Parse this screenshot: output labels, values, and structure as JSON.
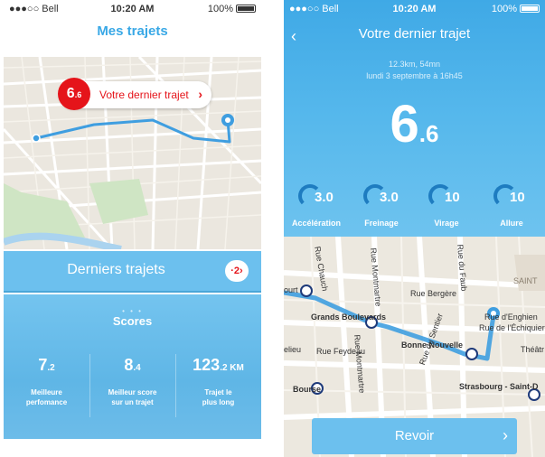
{
  "left": {
    "status": {
      "carrier": "●●●○○ Bell",
      "time": "10:20 AM",
      "battery": "100%"
    },
    "title": "Mes trajets",
    "last_trip": {
      "score_main": "6",
      "score_dec": ".6",
      "label": "Votre dernier trajet",
      "chevron": "›"
    },
    "recent": {
      "label": "Derniers trajets",
      "badge": "·2›"
    },
    "scores": {
      "title": "Scores",
      "sep": "• • •",
      "stats": [
        {
          "value": "7",
          "dec": ".2",
          "label1": "Meilleure",
          "label2": "perfomance"
        },
        {
          "value": "8",
          "dec": ".4",
          "label1": "Meilleur score",
          "label2": "sur un trajet"
        },
        {
          "value": "123",
          "dec": ".2 KM",
          "label1": "Trajet le",
          "label2": "plus long"
        }
      ]
    }
  },
  "right": {
    "status": {
      "carrier": "●●●○○ Bell",
      "time": "10:20 AM",
      "battery": "100%"
    },
    "back": "‹",
    "title": "Votre dernier trajet",
    "meta1": "12.3km, 54mn",
    "meta2": "lundi 3 septembre à 16h45",
    "score_main": "6",
    "score_dec": ".6",
    "metrics": [
      {
        "value": "3.0",
        "label": "Accélération"
      },
      {
        "value": "3.0",
        "label": "Freinage"
      },
      {
        "value": "10",
        "label": "Virage"
      },
      {
        "value": "10",
        "label": "Allure"
      }
    ],
    "map_labels": {
      "rue_chauch": "Rue Chauch",
      "montmartre_1": "Rue Montmartre",
      "rue_du_faub": "Rue du Faub",
      "rue_bergere": "Rue Bergère",
      "grands_boulevards": "Grands Boulevards",
      "rue_feydeau": "Rue Feydeau",
      "montmartre_2": "Rue Montmartre",
      "bonne_nouvelle": "Bonne Nouvelle",
      "rue_du_sentier": "Rue du Sentier",
      "bourse": "Bourse",
      "strasbourg": "Strasbourg - Saint-D",
      "saint": "SAINT",
      "rue_enghien": "Rue d'Enghien",
      "rue_echiquier": "Rue de l'Échiquier",
      "theatre": "Théâtr",
      "rue_poissonniere": "Rue Poissonnière",
      "ourt": "ourt",
      "elieu": "elieu"
    },
    "revoir": "Revoir",
    "revoir_chev": "›"
  },
  "colors": {
    "accent": "#39a8e6",
    "red": "#e5141a",
    "route": "#3f9ee0"
  }
}
